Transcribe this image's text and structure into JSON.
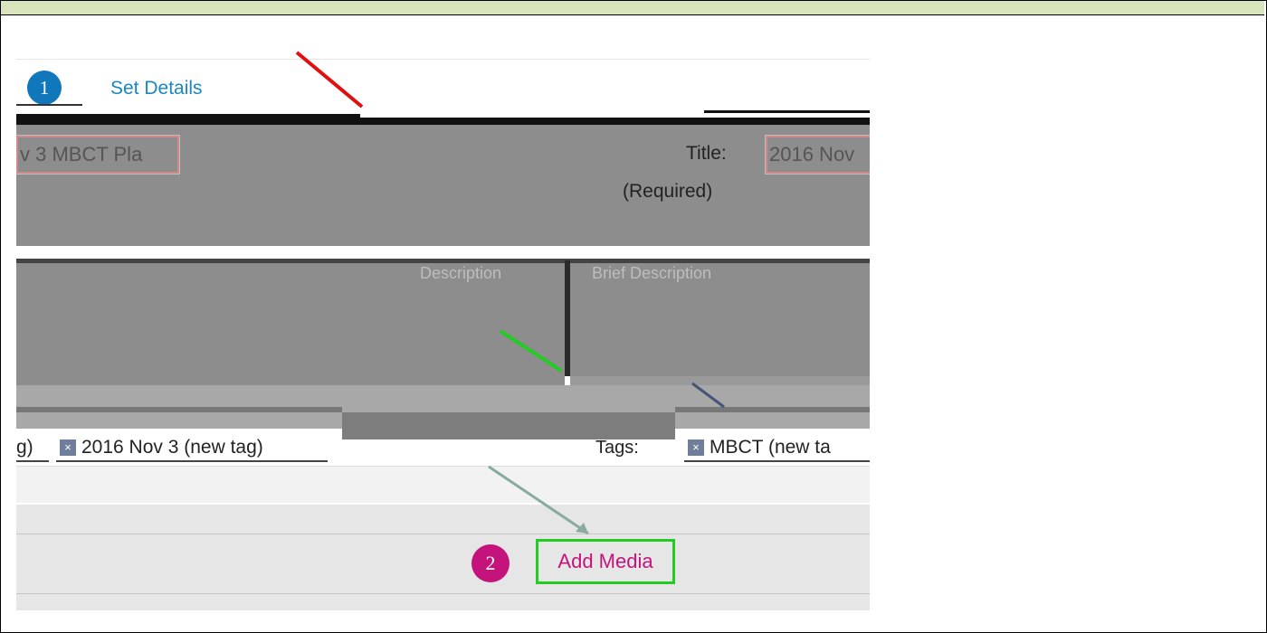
{
  "step1": {
    "number": "1",
    "label": "Set Details"
  },
  "fields": {
    "name_value": "v 3 MBCT Pla",
    "title_label": "Title:",
    "required_label": "(Required)",
    "title_value": "2016 Nov",
    "desc_left_label": "Description",
    "desc_right_label": "Brief Description"
  },
  "tags": {
    "label": "Tags:",
    "chip_partial": "g)",
    "chip_2016": "2016 Nov 3 (new tag)",
    "chip_mbct": "MBCT (new ta",
    "chip_remove": "×"
  },
  "step2": {
    "number": "2",
    "button_label": "Add Media"
  },
  "colors": {
    "header_band": "#d7e4bc",
    "step1_circle": "#1177bb",
    "step_title": "#1a86c8",
    "step2_circle": "#c4147c",
    "add_media_border": "#22cc22",
    "arrow_red": "#e01010",
    "arrow_green": "#22cc22"
  }
}
